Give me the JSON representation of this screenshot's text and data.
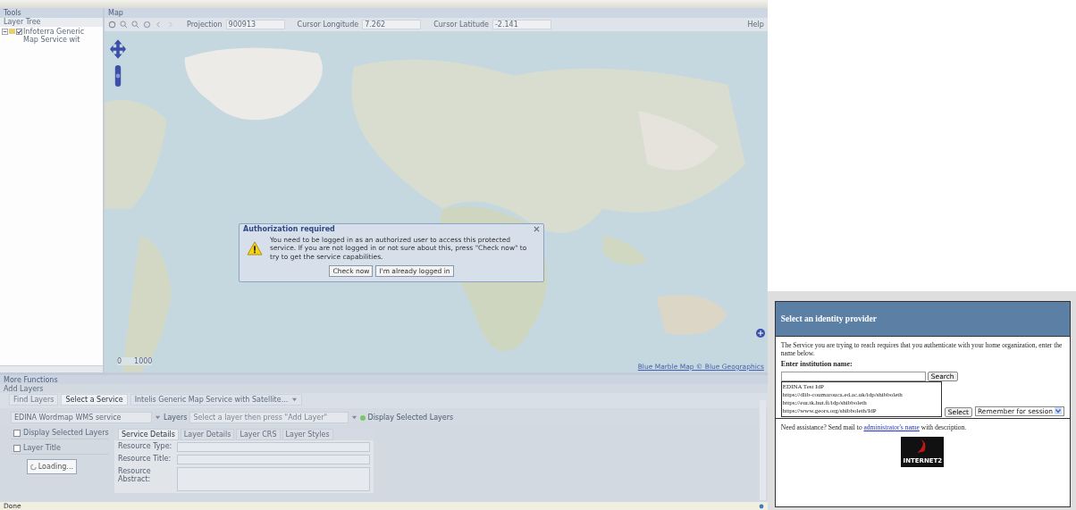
{
  "tools": {
    "title": "Tools",
    "layer_tree_label": "Layer Tree",
    "tree": [
      {
        "label": "Infoterra Generic Map Service wit",
        "checked": true,
        "expanded": true
      }
    ]
  },
  "map": {
    "title": "Map",
    "projection_label": "Projection",
    "projection": "900913",
    "lon_label": "Cursor Longitude",
    "lon": "7.262",
    "lat_label": "Cursor Latitude",
    "lat": "-2.141",
    "help": "Help",
    "scale": [
      "0",
      "1000"
    ],
    "attribution": "Blue Marble Map © Blue Geographics"
  },
  "dialog": {
    "title": "Authorization required",
    "message": "You need to be logged in as an authorized user to access this protected service. If you are not logged in or not sure about this, press \"Check now\" to try to get the service capabilities.",
    "buttons": [
      "Check now",
      "I'm already logged in"
    ]
  },
  "more_functions": {
    "title": "More Functions",
    "section": "Add Layers",
    "tabs": [
      {
        "label": "Find Layers",
        "selected": false
      },
      {
        "label": "Select a Service",
        "selected": true
      }
    ],
    "service_combo": "Intelis Generic Map Service with Satellite...",
    "service": "EDINA Wordmap WMS service",
    "layers_label": "Layers",
    "layers_placeholder": "Select a layer then press \"Add Layer\"",
    "display_button": "Display Selected Layers",
    "checks": [
      {
        "label": "Display Selected Layers",
        "checked": false
      },
      {
        "label": "Layer Title",
        "checked": false
      }
    ],
    "loading": "Loading...",
    "detail_tabs": [
      {
        "label": "Service Details",
        "selected": true
      },
      {
        "label": "Layer Details",
        "selected": false
      },
      {
        "label": "Layer CRS",
        "selected": false
      },
      {
        "label": "Layer Styles",
        "selected": false
      }
    ],
    "fields": [
      {
        "label": "Resource Type:",
        "kind": "line"
      },
      {
        "label": "Resource Title:",
        "kind": "line"
      },
      {
        "label": "Resource Abstract:",
        "kind": "area"
      }
    ]
  },
  "status_bar": "Done",
  "idp": {
    "title": "Select an identity provider",
    "intro": "The Service you are trying to reach requires that you authenticate with your home organization, enter the name below.",
    "label": "Enter institution name:",
    "search": "Search",
    "options": [
      {
        "label": "EDINA Test IdP",
        "selected": false
      },
      {
        "label": "https://dlib-coumarouca.ed.ac.uk/idp/shibboleth",
        "selected": false
      },
      {
        "label": "https://eur.tk.hut.fi/idp/shibboleth",
        "selected": false
      },
      {
        "label": "https://www.geors.org/shibboleth/IdP",
        "selected": false
      }
    ],
    "select": "Select",
    "remember": "Remember for session",
    "help_text": "Need assistance? Send mail to ",
    "help_link": "administrator's name",
    "help_tail": " with description.",
    "logo": "INTERNET2"
  }
}
